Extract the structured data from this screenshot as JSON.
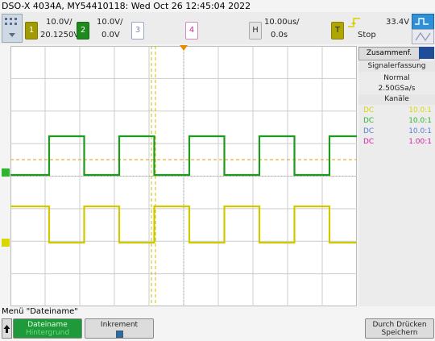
{
  "title": "DSO-X 4034A, MY54410118: Wed Oct 26 12:45:04 2022",
  "channels": [
    {
      "num": "1",
      "scale": "10.0V/",
      "offset": "20.1250V",
      "color": "#d2c800"
    },
    {
      "num": "2",
      "scale": "10.0V/",
      "offset": "0.0V",
      "color": "#1e9a1e"
    },
    {
      "num": "3",
      "color": "#7a88b8"
    },
    {
      "num": "4",
      "color": "#c0309a"
    }
  ],
  "timebase": {
    "label": "H",
    "scale": "10.00us/",
    "delay": "0.0s"
  },
  "trigger": {
    "label": "T",
    "level": "33.4V",
    "state": "Stop"
  },
  "side": {
    "tab": "Zusammenf.",
    "acq_title": "Signalerfassung",
    "acq_mode": "Normal",
    "acq_rate": "2.50GSa/s",
    "channels_title": "Kanäle",
    "channel_rows": [
      {
        "coupling": "DC",
        "probe": "10.0:1",
        "color": "#d8d800"
      },
      {
        "coupling": "DC",
        "probe": "10.0:1",
        "color": "#2db52d"
      },
      {
        "coupling": "DC",
        "probe": "10.0:1",
        "color": "#5b7bd6"
      },
      {
        "coupling": "DC",
        "probe": "1.00:1",
        "color": "#d21fa0"
      }
    ]
  },
  "menu": {
    "label": "Menü \"Dateiname\"",
    "btn1_top": "Dateiname",
    "btn1_bottom": "Hintergrund",
    "btn2": "Inkrement",
    "btn3_top": "Durch Drücken",
    "btn3_bottom": "Speichern"
  },
  "colors": {
    "ch1": "#d2c800",
    "ch2": "#1e9a1e",
    "ch3": "#7a88b8",
    "ch4": "#c0309a",
    "trig_marker": "#e88b00"
  }
}
